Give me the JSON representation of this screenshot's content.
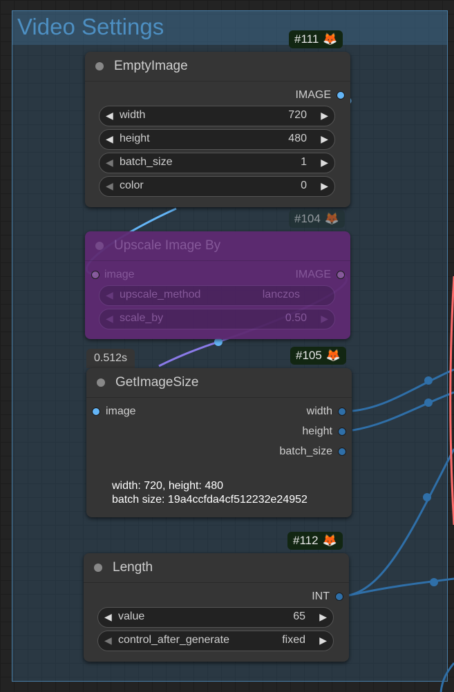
{
  "group": {
    "title": "Video Settings"
  },
  "nodes": {
    "empty_image": {
      "id_badge": "#111",
      "title": "EmptyImage",
      "output_label": "IMAGE",
      "widgets": [
        {
          "name": "width",
          "value": "720"
        },
        {
          "name": "height",
          "value": "480"
        },
        {
          "name": "batch_size",
          "value": "1"
        },
        {
          "name": "color",
          "value": "0"
        }
      ]
    },
    "upscale": {
      "id_badge": "#104",
      "title": "Upscale Image By",
      "input_label": "image",
      "output_label": "IMAGE",
      "widgets": [
        {
          "name": "upscale_method",
          "value": "lanczos"
        },
        {
          "name": "scale_by",
          "value": "0.50"
        }
      ]
    },
    "get_image_size": {
      "id_badge": "#105",
      "timer": "0.512s",
      "title": "GetImageSize",
      "input_label": "image",
      "outputs": [
        "width",
        "height",
        "batch_size"
      ],
      "info_line1": "width: 720, height: 480",
      "info_line2": "batch size: 19a4ccfda4cf512232e24952"
    },
    "length": {
      "id_badge": "#112",
      "title": "Length",
      "output_label": "INT",
      "widgets": [
        {
          "name": "value",
          "value": "65"
        },
        {
          "name": "control_after_generate",
          "value": "fixed"
        }
      ]
    }
  },
  "icons": {
    "badge_icon": "fox-icon",
    "arrow_left": "◀",
    "arrow_right": "▶",
    "fox": "🦊"
  },
  "colors": {
    "image_link": "#64b5f6",
    "int_link": "#2f6fa8",
    "bypass": "#6a2a80",
    "red_link": "#ff6b6b"
  }
}
